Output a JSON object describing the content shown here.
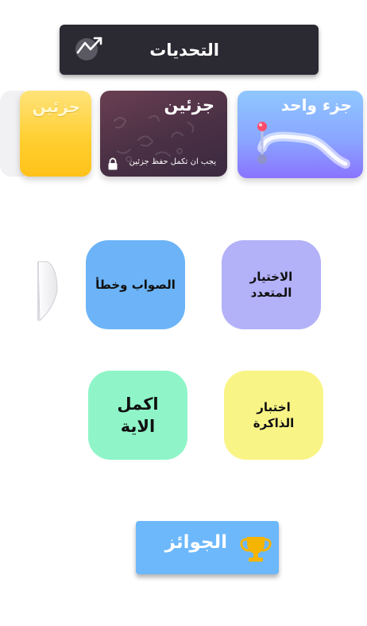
{
  "header": {
    "title": "التحديات",
    "icon": "trend-chart-icon"
  },
  "levels": [
    {
      "title": "جزء واحد",
      "icon": "path-route-icon",
      "colors": [
        "#8fc7ff",
        "#8a73ff"
      ]
    },
    {
      "title": "جزئين",
      "note": "يجب ان تكمل حفظ جزئين",
      "locked": true,
      "icon": "lock-icon"
    },
    {
      "title": "جزئين",
      "colors": [
        "#ffe37a",
        "#ffc21a"
      ]
    }
  ],
  "modes": {
    "multiple_choice": "الاختيار المتعدد",
    "true_false": "الصواب وخطأ",
    "memory_test": "اختبار الذاكرة",
    "complete_verse": "اكمل الاية"
  },
  "awards": {
    "label": "الجوائز",
    "icon": "trophy-icon"
  }
}
